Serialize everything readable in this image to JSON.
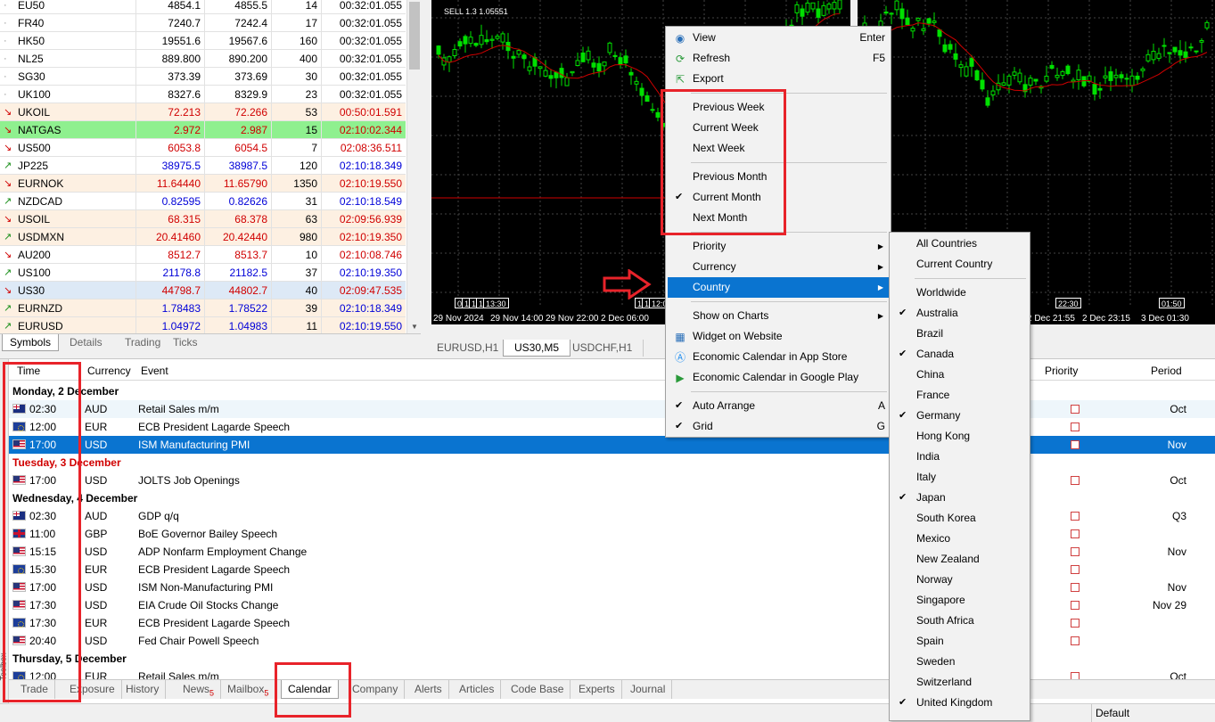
{
  "market_watch": {
    "rows": [
      {
        "arrow": "",
        "symbol": "EU50",
        "bid": "4854.1",
        "ask": "4855.5",
        "spread": "14",
        "time": "00:32:01.055",
        "color": "black",
        "bg": "#ffffff"
      },
      {
        "arrow": "",
        "symbol": "FR40",
        "bid": "7240.7",
        "ask": "7242.4",
        "spread": "17",
        "time": "00:32:01.055",
        "color": "black",
        "bg": "#ffffff"
      },
      {
        "arrow": "",
        "symbol": "HK50",
        "bid": "19551.6",
        "ask": "19567.6",
        "spread": "160",
        "time": "00:32:01.055",
        "color": "black",
        "bg": "#ffffff"
      },
      {
        "arrow": "",
        "symbol": "NL25",
        "bid": "889.800",
        "ask": "890.200",
        "spread": "400",
        "time": "00:32:01.055",
        "color": "black",
        "bg": "#ffffff"
      },
      {
        "arrow": "",
        "symbol": "SG30",
        "bid": "373.39",
        "ask": "373.69",
        "spread": "30",
        "time": "00:32:01.055",
        "color": "black",
        "bg": "#ffffff"
      },
      {
        "arrow": "",
        "symbol": "UK100",
        "bid": "8327.6",
        "ask": "8329.9",
        "spread": "23",
        "time": "00:32:01.055",
        "color": "black",
        "bg": "#ffffff"
      },
      {
        "arrow": "down",
        "symbol": "UKOIL",
        "bid": "72.213",
        "ask": "72.266",
        "spread": "53",
        "time": "00:50:01.591",
        "color": "red",
        "bg": "#fdf0e2"
      },
      {
        "arrow": "down",
        "symbol": "NATGAS",
        "bid": "2.972",
        "ask": "2.987",
        "spread": "15",
        "time": "02:10:02.344",
        "color": "red",
        "bg": "#8ff08f"
      },
      {
        "arrow": "down",
        "symbol": "US500",
        "bid": "6053.8",
        "ask": "6054.5",
        "spread": "7",
        "time": "02:08:36.511",
        "color": "red",
        "bg": "#ffffff"
      },
      {
        "arrow": "up",
        "symbol": "JP225",
        "bid": "38975.5",
        "ask": "38987.5",
        "spread": "120",
        "time": "02:10:18.349",
        "color": "blue",
        "bg": "#ffffff"
      },
      {
        "arrow": "down",
        "symbol": "EURNOK",
        "bid": "11.64440",
        "ask": "11.65790",
        "spread": "1350",
        "time": "02:10:19.550",
        "color": "red",
        "bg": "#fdf0e2"
      },
      {
        "arrow": "up",
        "symbol": "NZDCAD",
        "bid": "0.82595",
        "ask": "0.82626",
        "spread": "31",
        "time": "02:10:18.549",
        "color": "blue",
        "bg": "#ffffff"
      },
      {
        "arrow": "down",
        "symbol": "USOIL",
        "bid": "68.315",
        "ask": "68.378",
        "spread": "63",
        "time": "02:09:56.939",
        "color": "red",
        "bg": "#fdf0e2"
      },
      {
        "arrow": "up",
        "symbol": "USDMXN",
        "bid": "20.41460",
        "ask": "20.42440",
        "spread": "980",
        "time": "02:10:19.350",
        "color": "red",
        "bg": "#fdf0e2"
      },
      {
        "arrow": "down",
        "symbol": "AU200",
        "bid": "8512.7",
        "ask": "8513.7",
        "spread": "10",
        "time": "02:10:08.746",
        "color": "red",
        "bg": "#ffffff"
      },
      {
        "arrow": "up",
        "symbol": "US100",
        "bid": "21178.8",
        "ask": "21182.5",
        "spread": "37",
        "time": "02:10:19.350",
        "color": "blue",
        "bg": "#ffffff"
      },
      {
        "arrow": "down",
        "symbol": "US30",
        "bid": "44798.7",
        "ask": "44802.7",
        "spread": "40",
        "time": "02:09:47.535",
        "color": "red",
        "bg": "#dde9f6"
      },
      {
        "arrow": "up",
        "symbol": "EURNZD",
        "bid": "1.78483",
        "ask": "1.78522",
        "spread": "39",
        "time": "02:10:18.349",
        "color": "blue",
        "bg": "#fdf0e2"
      },
      {
        "arrow": "up",
        "symbol": "EURUSD",
        "bid": "1.04972",
        "ask": "1.04983",
        "spread": "11",
        "time": "02:10:19.550",
        "color": "blue",
        "bg": "#fdf0e2"
      }
    ],
    "tabs": [
      "Symbols",
      "Details",
      "Trading",
      "Ticks"
    ]
  },
  "charts": {
    "left_trade_label": "SELL 1.3 1.05551",
    "left_axis": [
      "29 Nov 2024",
      "29 Nov 14:00",
      "29 Nov 22:00",
      "2 Dec 06:00"
    ],
    "left_badges": [
      "0",
      "1",
      "1",
      "1",
      "13:30",
      "1",
      "1",
      "12:0"
    ],
    "right_axis": [
      "2 Dec 21:55",
      "2 Dec 23:15",
      "3 Dec 01:30"
    ],
    "right_badges": [
      "22:30",
      "01:50"
    ],
    "tabs": [
      "EURUSD,H1",
      "US30,M5",
      "USDCHF,H1"
    ]
  },
  "calendar": {
    "headers": {
      "time": "Time",
      "currency": "Currency",
      "event": "Event",
      "priority": "Priority",
      "period": "Period"
    },
    "rows": [
      {
        "type": "day",
        "label": "Monday, 2 December",
        "today": false
      },
      {
        "type": "event",
        "flag": "au",
        "time": "02:30",
        "currency": "AUD",
        "event": "Retail Sales m/m",
        "period": "Oct",
        "alt": true
      },
      {
        "type": "event",
        "flag": "eu",
        "time": "12:00",
        "currency": "EUR",
        "event": "ECB President Lagarde Speech",
        "period": ""
      },
      {
        "type": "event",
        "flag": "us",
        "time": "17:00",
        "currency": "USD",
        "event": "ISM Manufacturing PMI",
        "period": "Nov",
        "selected": true
      },
      {
        "type": "day",
        "label": "Tuesday, 3 December",
        "today": true
      },
      {
        "type": "event",
        "flag": "us",
        "time": "17:00",
        "currency": "USD",
        "event": "JOLTS Job Openings",
        "period": "Oct"
      },
      {
        "type": "day",
        "label": "Wednesday, 4 December",
        "today": false
      },
      {
        "type": "event",
        "flag": "au",
        "time": "02:30",
        "currency": "AUD",
        "event": "GDP q/q",
        "period": "Q3"
      },
      {
        "type": "event",
        "flag": "gb",
        "time": "11:00",
        "currency": "GBP",
        "event": "BoE Governor Bailey Speech",
        "period": ""
      },
      {
        "type": "event",
        "flag": "us",
        "time": "15:15",
        "currency": "USD",
        "event": "ADP Nonfarm Employment Change",
        "period": "Nov"
      },
      {
        "type": "event",
        "flag": "eu",
        "time": "15:30",
        "currency": "EUR",
        "event": "ECB President Lagarde Speech",
        "period": ""
      },
      {
        "type": "event",
        "flag": "us",
        "time": "17:00",
        "currency": "USD",
        "event": "ISM Non-Manufacturing PMI",
        "period": "Nov"
      },
      {
        "type": "event",
        "flag": "us",
        "time": "17:30",
        "currency": "USD",
        "event": "EIA Crude Oil Stocks Change",
        "period": "Nov 29"
      },
      {
        "type": "event",
        "flag": "eu",
        "time": "17:30",
        "currency": "EUR",
        "event": "ECB President Lagarde Speech",
        "period": ""
      },
      {
        "type": "event",
        "flag": "us",
        "time": "20:40",
        "currency": "USD",
        "event": "Fed Chair Powell Speech",
        "period": ""
      },
      {
        "type": "day",
        "label": "Thursday, 5 December",
        "today": false
      },
      {
        "type": "event",
        "flag": "eu",
        "time": "12:00",
        "currency": "EUR",
        "event": "Retail Sales m/m",
        "period": "Oct"
      }
    ]
  },
  "toolbox": {
    "strip_label": "Toolbox",
    "tabs": [
      {
        "label": "Trade",
        "badge": ""
      },
      {
        "label": "Exposure",
        "badge": ""
      },
      {
        "label": "History",
        "badge": ""
      },
      {
        "label": "News",
        "badge": "5"
      },
      {
        "label": "Mailbox",
        "badge": "5"
      },
      {
        "label": "Calendar",
        "badge": ""
      },
      {
        "label": "Company",
        "badge": ""
      },
      {
        "label": "Alerts",
        "badge": ""
      },
      {
        "label": "Articles",
        "badge": ""
      },
      {
        "label": "Code Base",
        "badge": ""
      },
      {
        "label": "Experts",
        "badge": ""
      },
      {
        "label": "Journal",
        "badge": ""
      }
    ],
    "active_tab": "Calendar"
  },
  "status_bar": {
    "profile": "Default"
  },
  "context_menu": {
    "items": [
      {
        "type": "item",
        "label": "View",
        "key": "Enter",
        "icon": "eye-icon"
      },
      {
        "type": "item",
        "label": "Refresh",
        "key": "F5",
        "icon": "refresh-icon"
      },
      {
        "type": "item",
        "label": "Export",
        "key": "",
        "icon": "export-icon"
      },
      {
        "type": "sep"
      },
      {
        "type": "item",
        "label": "Previous Week",
        "key": ""
      },
      {
        "type": "item",
        "label": "Current Week",
        "key": ""
      },
      {
        "type": "item",
        "label": "Next Week",
        "key": ""
      },
      {
        "type": "sep"
      },
      {
        "type": "item",
        "label": "Previous Month",
        "key": ""
      },
      {
        "type": "item",
        "label": "Current Month",
        "key": "",
        "checked": true
      },
      {
        "type": "item",
        "label": "Next Month",
        "key": ""
      },
      {
        "type": "sep"
      },
      {
        "type": "item",
        "label": "Priority",
        "submenu": true
      },
      {
        "type": "item",
        "label": "Currency",
        "submenu": true
      },
      {
        "type": "item",
        "label": "Country",
        "submenu": true,
        "highlighted": true
      },
      {
        "type": "sep"
      },
      {
        "type": "item",
        "label": "Show on Charts",
        "submenu": true
      },
      {
        "type": "item",
        "label": "Widget on Website",
        "icon": "widget-icon"
      },
      {
        "type": "item",
        "label": "Economic Calendar in App Store",
        "icon": "app-store-icon"
      },
      {
        "type": "item",
        "label": "Economic Calendar in Google Play",
        "icon": "google-play-icon"
      },
      {
        "type": "sep"
      },
      {
        "type": "item",
        "label": "Auto Arrange",
        "key": "A",
        "checked": true
      },
      {
        "type": "item",
        "label": "Grid",
        "key": "G",
        "checked": true
      }
    ]
  },
  "country_submenu": {
    "items": [
      {
        "type": "item",
        "label": "All Countries"
      },
      {
        "type": "item",
        "label": "Current Country"
      },
      {
        "type": "sep"
      },
      {
        "type": "item",
        "label": "Worldwide"
      },
      {
        "type": "item",
        "label": "Australia",
        "checked": true
      },
      {
        "type": "item",
        "label": "Brazil"
      },
      {
        "type": "item",
        "label": "Canada",
        "checked": true
      },
      {
        "type": "item",
        "label": "China"
      },
      {
        "type": "item",
        "label": "France"
      },
      {
        "type": "item",
        "label": "Germany",
        "checked": true
      },
      {
        "type": "item",
        "label": "Hong Kong"
      },
      {
        "type": "item",
        "label": "India"
      },
      {
        "type": "item",
        "label": "Italy"
      },
      {
        "type": "item",
        "label": "Japan",
        "checked": true
      },
      {
        "type": "item",
        "label": "South Korea"
      },
      {
        "type": "item",
        "label": "Mexico"
      },
      {
        "type": "item",
        "label": "New Zealand"
      },
      {
        "type": "item",
        "label": "Norway"
      },
      {
        "type": "item",
        "label": "Singapore"
      },
      {
        "type": "item",
        "label": "South Africa"
      },
      {
        "type": "item",
        "label": "Spain"
      },
      {
        "type": "item",
        "label": "Sweden"
      },
      {
        "type": "item",
        "label": "Switzerland"
      },
      {
        "type": "item",
        "label": "United Kingdom",
        "checked": true
      }
    ]
  },
  "colors": {
    "accent": "#0a74d0",
    "annotation": "#e8232a",
    "candle": "#00e000",
    "ma_line": "#d00000"
  }
}
